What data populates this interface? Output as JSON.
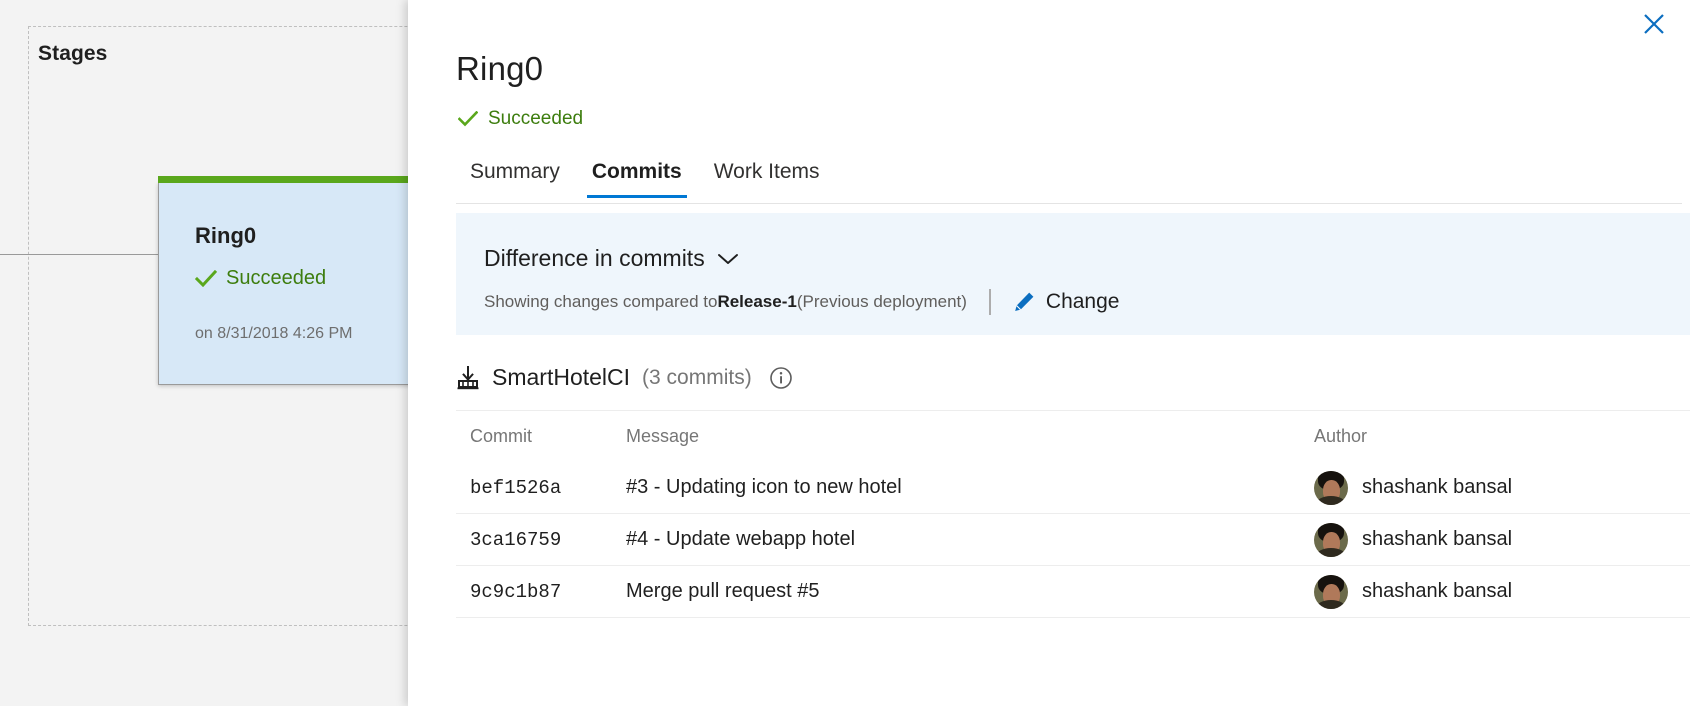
{
  "canvas": {
    "group_title": "Stages",
    "stage_card": {
      "name": "Ring0",
      "status": "Succeeded",
      "date": "on 8/31/2018 4:26 PM",
      "bar_color": "#5aa71c",
      "body_color": "#d7e8f7"
    }
  },
  "panel": {
    "title": "Ring0",
    "status": "Succeeded",
    "status_color": "#3d7d0e",
    "close_label": "✕",
    "tabs": [
      {
        "label": "Summary",
        "active": false
      },
      {
        "label": "Commits",
        "active": true
      },
      {
        "label": "Work Items",
        "active": false
      }
    ],
    "banner": {
      "title": "Difference in commits",
      "chevron": "chevron-down-icon",
      "sub_prefix": "Showing changes compared to ",
      "sub_bold": "Release-1",
      "sub_suffix": " (Previous deployment)",
      "change_label": "Change",
      "background": "#eff6fc",
      "accent": "#0078d4"
    },
    "artifact": {
      "icon": "artifact-download-icon",
      "name": "SmartHotelCI",
      "count": "(3 commits)",
      "info_icon": "info-icon"
    },
    "table": {
      "columns": [
        "Commit",
        "Message",
        "Author"
      ],
      "rows": [
        {
          "commit": "bef1526a",
          "message": "#3 - Updating icon to new hotel",
          "author": "shashank bansal"
        },
        {
          "commit": "3ca16759",
          "message": "#4 - Update webapp hotel",
          "author": "shashank bansal"
        },
        {
          "commit": "9c9c1b87",
          "message": "Merge pull request #5",
          "author": "shashank bansal"
        }
      ]
    }
  }
}
